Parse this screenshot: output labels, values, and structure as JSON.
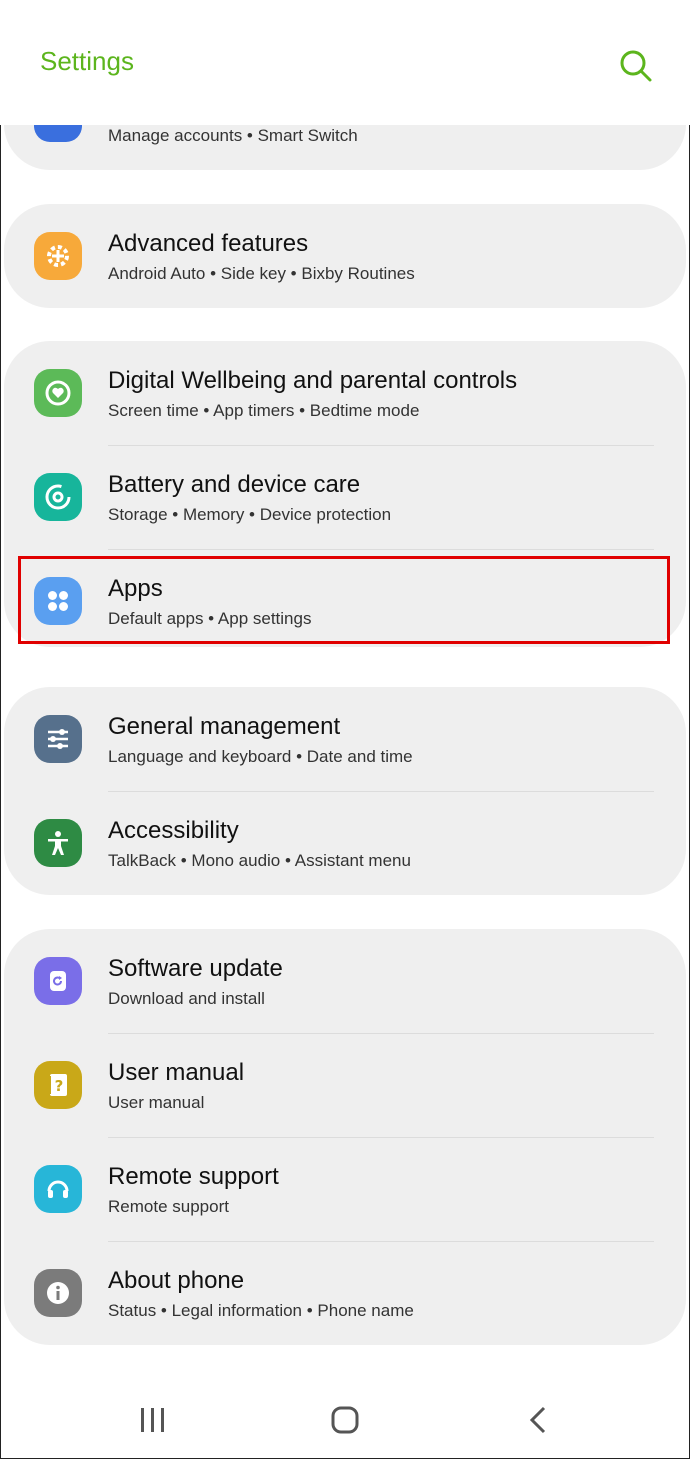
{
  "header": {
    "title": "Settings"
  },
  "rows": {
    "accounts": {
      "title": "",
      "subtitle": "Manage accounts • Smart Switch",
      "icon": "accounts-backup-icon",
      "color": "#3a6fde"
    },
    "advanced": {
      "title": "Advanced features",
      "subtitle": "Android Auto • Side key • Bixby Routines",
      "icon": "plus-gear-icon",
      "color": "#f7a93a"
    },
    "wellbeing": {
      "title": "Digital Wellbeing and parental controls",
      "subtitle": "Screen time • App timers • Bedtime mode",
      "icon": "heart-ring-icon",
      "color": "#5cba58"
    },
    "battery": {
      "title": "Battery and device care",
      "subtitle": "Storage • Memory • Device protection",
      "icon": "refresh-ring-icon",
      "color": "#17b59b"
    },
    "apps": {
      "title": "Apps",
      "subtitle": "Default apps • App settings",
      "icon": "four-dots-icon",
      "color": "#5a9ff0"
    },
    "general": {
      "title": "General management",
      "subtitle": "Language and keyboard • Date and time",
      "icon": "sliders-icon",
      "color": "#56708c"
    },
    "accessibility": {
      "title": "Accessibility",
      "subtitle": "TalkBack • Mono audio • Assistant menu",
      "icon": "person-icon",
      "color": "#2e8b44"
    },
    "software": {
      "title": "Software update",
      "subtitle": "Download and install",
      "icon": "update-icon",
      "color": "#7a6ee8"
    },
    "manual": {
      "title": "User manual",
      "subtitle": "User manual",
      "icon": "book-question-icon",
      "color": "#c9a818"
    },
    "remote": {
      "title": "Remote support",
      "subtitle": "Remote support",
      "icon": "headset-icon",
      "color": "#27b6d8"
    },
    "about": {
      "title": "About phone",
      "subtitle": "Status • Legal information • Phone name",
      "icon": "info-icon",
      "color": "#7b7b7b"
    }
  },
  "accent": "#5cb51d",
  "highlight_color": "#e00000"
}
